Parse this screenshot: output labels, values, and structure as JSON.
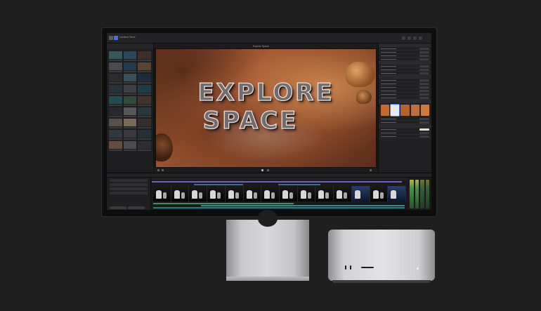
{
  "app": {
    "library_title": "Limited Time",
    "viewer_label": "Explore Space",
    "timeline_title": "Explore Space"
  },
  "viewer": {
    "title_line_1": "EXPLORE",
    "title_line_2": "SPACE"
  },
  "colors": {
    "background": "#1f1f1f",
    "timeline_purple": "#6f5fc7",
    "terrain": "#a45a33",
    "audio_meter": "#4da64f"
  },
  "hardware": {
    "display_stand": "stand",
    "computer": "desktop"
  },
  "icons": [
    "window-controls-icon",
    "toolbar-icon",
    "play-icon",
    "meter-icon"
  ]
}
